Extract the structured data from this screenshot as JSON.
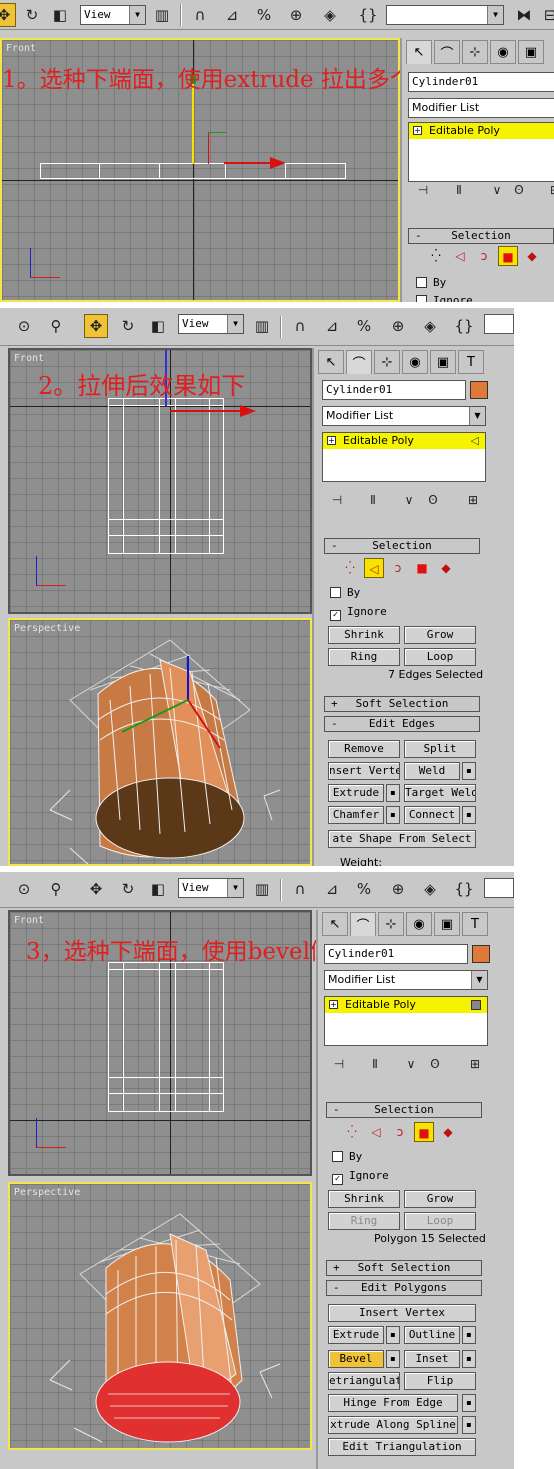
{
  "toolbar": {
    "view_label": "View",
    "superscript_snap": "3"
  },
  "panel1": {
    "caption": "1。选种下端面，使用extrude 拉出多个面",
    "viewport_front": "Front",
    "object_name": "Cylinder01",
    "modifier_list": "Modifier List",
    "stack_item": "Editable Poly",
    "selection_title": "Selection",
    "by_label": "By",
    "ignore_label": "Ignore"
  },
  "panel2": {
    "caption": "2。拉伸后效果如下",
    "viewport_front": "Front",
    "viewport_persp": "Perspective",
    "object_name": "Cylinder01",
    "object_color": "#e07a3a",
    "modifier_list": "Modifier List",
    "stack_item": "Editable Poly",
    "selection_title": "Selection",
    "by_label": "By",
    "ignore_label": "Ignore",
    "shrink": "Shrink",
    "grow": "Grow",
    "ring": "Ring",
    "loop": "Loop",
    "status": "7 Edges Selected",
    "soft_selection": "Soft Selection",
    "edit_edges": "Edit Edges",
    "buttons": [
      {
        "left": "Remove",
        "right": "Split"
      },
      {
        "left": "nsert Verte",
        "right": "Weld"
      },
      {
        "left": "Extrude",
        "right": "Target Weld"
      },
      {
        "left": "Chamfer",
        "right": "Connect"
      }
    ],
    "create_shape": "ate Shape From Select",
    "weight_label": "Weight:"
  },
  "panel3": {
    "caption": "3，选种下端面，使用bevel倒出一个面",
    "viewport_front": "Front",
    "viewport_persp": "Perspective",
    "object_name": "Cylinder01",
    "object_color": "#e07a3a",
    "modifier_list": "Modifier List",
    "stack_item": "Editable Poly",
    "selection_title": "Selection",
    "by_label": "By",
    "ignore_label": "Ignore",
    "shrink": "Shrink",
    "grow": "Grow",
    "ring": "Ring",
    "loop": "Loop",
    "status": "Polygon 15 Selected",
    "soft_selection": "Soft Selection",
    "edit_polygons": "Edit Polygons",
    "insert_vertex": "Insert Vertex",
    "buttons": [
      {
        "left": "Extrude",
        "right": "Outline"
      },
      {
        "left": "Bevel",
        "right": "Inset"
      },
      {
        "left": "etriangulat",
        "right": "Flip"
      }
    ],
    "hinge": "Hinge From Edge",
    "extrude_spline": "xtrude Along Spline",
    "edit_triangulation": "Edit Triangulation"
  },
  "colors": {
    "caption": "#e02020",
    "stack_highlight": "#f6f300",
    "active_button": "#f0c238",
    "object": "#e07a3a",
    "selected_face": "#e03030"
  }
}
